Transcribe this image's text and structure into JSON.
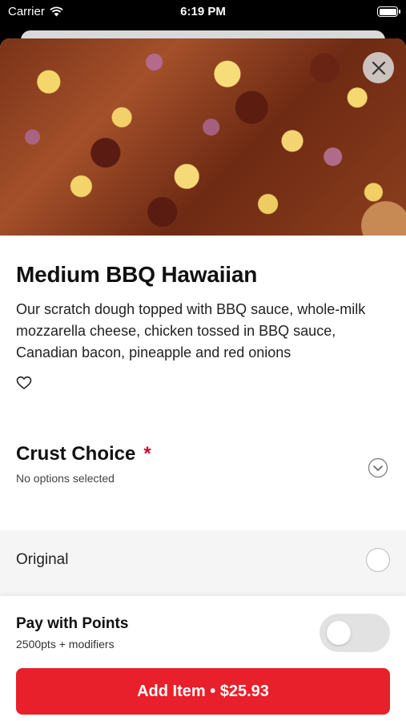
{
  "status_bar": {
    "carrier": "Carrier",
    "time": "6:19 PM"
  },
  "item": {
    "title": "Medium BBQ Hawaiian",
    "description": "Our scratch dough topped with BBQ sauce, whole-milk mozzarella cheese, chicken tossed in BBQ sauce, Canadian bacon, pineapple and red onions"
  },
  "crust": {
    "title": "Crust Choice",
    "required_mark": "*",
    "subtitle": "No options selected",
    "options": [
      {
        "label": "Original",
        "selected": false
      }
    ]
  },
  "points": {
    "title": "Pay with Points",
    "subtitle": "2500pts + modifiers",
    "enabled": false
  },
  "add_button": {
    "label": "Add Item • $25.93"
  },
  "colors": {
    "accent": "#e8202b",
    "required": "#c8102e"
  },
  "icons": [
    "wifi-icon",
    "battery-icon",
    "close-icon",
    "heart-icon",
    "chevron-down-icon",
    "radio-icon"
  ]
}
